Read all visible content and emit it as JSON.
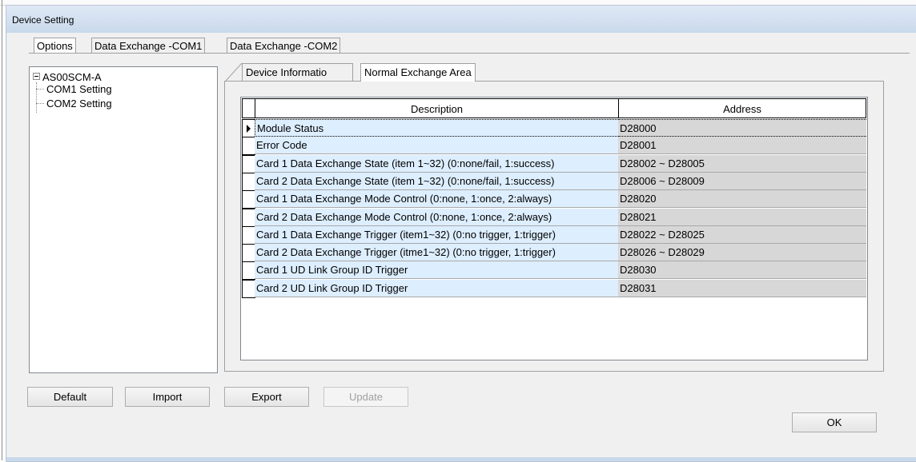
{
  "window": {
    "title": "Device Setting"
  },
  "outer_tabs": [
    {
      "label": "Options",
      "active": true
    },
    {
      "label": "Data Exchange -COM1",
      "active": false
    },
    {
      "label": "Data Exchange -COM2",
      "active": false
    }
  ],
  "tree": {
    "root": "AS00SCM-A",
    "children": [
      "COM1 Setting",
      "COM2 Setting"
    ]
  },
  "inner_tabs": [
    {
      "label": "Device Informatio",
      "active": false
    },
    {
      "label": "Normal Exchange Area",
      "active": true
    }
  ],
  "grid": {
    "columns": [
      "Description",
      "Address"
    ],
    "rows": [
      {
        "description": "Module Status",
        "address": "D28000"
      },
      {
        "description": "Error Code",
        "address": "D28001"
      },
      {
        "description": "Card 1 Data Exchange State (item 1~32) (0:none/fail, 1:success)",
        "address": "D28002 ~ D28005"
      },
      {
        "description": "Card 2 Data Exchange State (item 1~32) (0:none/fail, 1:success)",
        "address": "D28006 ~ D28009"
      },
      {
        "description": "Card 1 Data Exchange Mode Control (0:none, 1:once, 2:always)",
        "address": "D28020"
      },
      {
        "description": "Card 2 Data Exchange Mode Control (0:none, 1:once, 2:always)",
        "address": "D28021"
      },
      {
        "description": "Card 1 Data Exchange Trigger (item1~32) (0:no trigger, 1:trigger)",
        "address": "D28022 ~ D28025"
      },
      {
        "description": "Card 2 Data Exchange Trigger (itme1~32) (0:no trigger, 1:trigger)",
        "address": "D28026 ~ D28029"
      },
      {
        "description": "Card 1 UD Link Group ID Trigger",
        "address": "D28030"
      },
      {
        "description": "Card 2 UD Link Group ID Trigger",
        "address": "D28031"
      }
    ]
  },
  "buttons": {
    "default": "Default",
    "import": "Import",
    "export": "Export",
    "update": "Update",
    "ok": "OK"
  },
  "colors": {
    "title_bar": "#c9d9ec",
    "description_cell": "#ddeeff",
    "address_cell": "#d7d7d7",
    "dialog_bg": "#f0f0f0"
  }
}
